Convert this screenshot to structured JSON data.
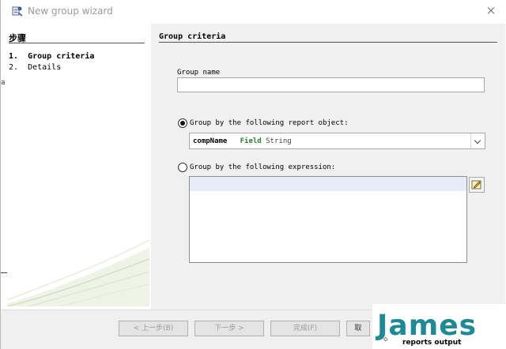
{
  "window": {
    "title": "New group wizard",
    "close_glyph": "×",
    "icon": "wizard-app-icon"
  },
  "steps": {
    "title": "步骤",
    "items": [
      {
        "label": "1.  Group criteria",
        "active": true
      },
      {
        "label": "2.  Details",
        "active": false
      }
    ]
  },
  "side_fragments": {
    "left_edge_text": "a"
  },
  "page": {
    "title": "Group criteria",
    "group_name_label": "Group name",
    "group_name_value": "",
    "option_report_object": {
      "label": "Group by the following report object:",
      "checked": true
    },
    "report_object": {
      "name": "compName",
      "kind": "Field",
      "type": "String"
    },
    "option_expression": {
      "label": "Group by the following expression:",
      "checked": false
    },
    "expression_value": "",
    "expression_button_icon": "expression-editor-icon"
  },
  "buttons": {
    "back": "< 上一步(B)",
    "next": "下一步 >",
    "finish": "完成(F)",
    "cancel": "取"
  },
  "watermark": {
    "text": "James",
    "under_text": "reports output",
    "glyph": "◇"
  },
  "colors": {
    "field_kind": "#2e7d32",
    "watermark": "#1d8a96",
    "panel_bg": "#f0f0f0"
  }
}
